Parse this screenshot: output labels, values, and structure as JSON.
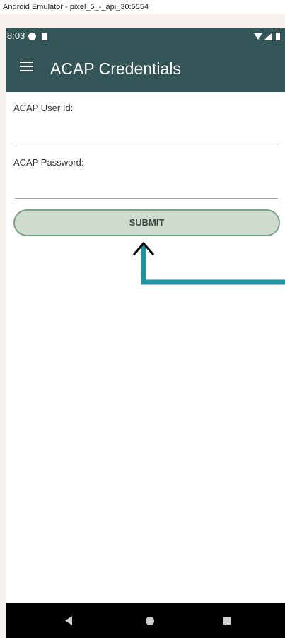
{
  "window": {
    "title": "Android Emulator - pixel_5_-_api_30:5554"
  },
  "status_bar": {
    "time": "8:03"
  },
  "app_bar": {
    "title": "ACAP Credentials"
  },
  "form": {
    "user_id_label": "ACAP User Id:",
    "user_id_value": "",
    "password_label": "ACAP Password:",
    "password_value": "",
    "submit_label": "SUBMIT"
  },
  "icons": {
    "menu": "hamburger-menu-icon",
    "back": "nav-back-icon",
    "home": "nav-home-icon",
    "recent": "nav-recent-apps-icon"
  },
  "colors": {
    "app_bar": "#355659",
    "button_fill": "#d0dbd0",
    "button_border": "#7aa287",
    "annotation_arrow": "#1f93a3"
  }
}
